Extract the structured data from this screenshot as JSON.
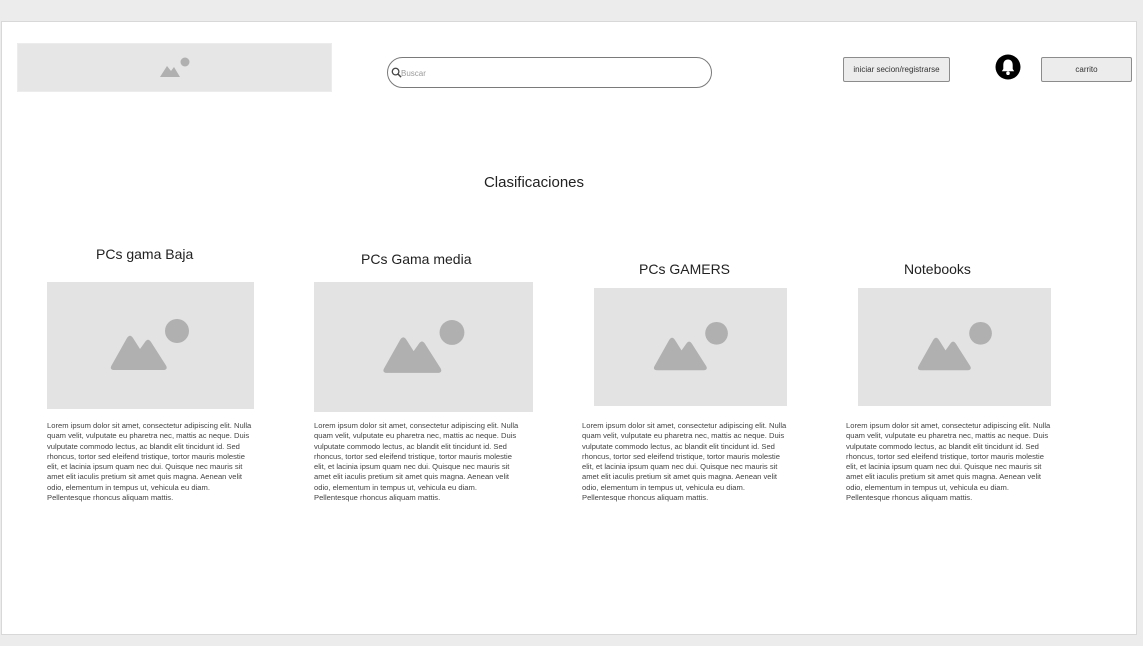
{
  "header": {
    "search_placeholder": "Buscar",
    "login_label": "iniciar secion/registrarse",
    "cart_label": "carrito"
  },
  "main": {
    "section_title": "Clasificaciones",
    "categories": [
      {
        "title": "PCs gama Baja",
        "description": "Lorem ipsum dolor sit amet, consectetur adipiscing elit. Nulla quam velit, vulputate eu pharetra nec, mattis ac neque. Duis vulputate commodo lectus, ac blandit elit tincidunt id. Sed rhoncus, tortor sed eleifend tristique, tortor mauris molestie elit, et lacinia ipsum quam nec dui. Quisque nec mauris sit amet elit iaculis pretium sit amet quis magna. Aenean velit odio, elementum in tempus ut, vehicula eu diam. Pellentesque rhoncus aliquam mattis."
      },
      {
        "title": "PCs Gama media",
        "description": "Lorem ipsum dolor sit amet, consectetur adipiscing elit. Nulla quam velit, vulputate eu pharetra nec, mattis ac neque. Duis vulputate commodo lectus, ac blandit elit tincidunt id. Sed rhoncus, tortor sed eleifend tristique, tortor mauris molestie elit, et lacinia ipsum quam nec dui. Quisque nec mauris sit amet elit iaculis pretium sit amet quis magna. Aenean velit odio, elementum in tempus ut, vehicula eu diam. Pellentesque rhoncus aliquam mattis."
      },
      {
        "title": "PCs GAMERS",
        "description": "Lorem ipsum dolor sit amet, consectetur adipiscing elit. Nulla quam velit, vulputate eu pharetra nec, mattis ac neque. Duis vulputate commodo lectus, ac blandit elit tincidunt id. Sed rhoncus, tortor sed eleifend tristique, tortor mauris molestie elit, et lacinia ipsum quam nec dui. Quisque nec mauris sit amet elit iaculis pretium sit amet quis magna. Aenean velit odio, elementum in tempus ut, vehicula eu diam. Pellentesque rhoncus aliquam mattis."
      },
      {
        "title": "Notebooks",
        "description": "Lorem ipsum dolor sit amet, consectetur adipiscing elit. Nulla quam velit, vulputate eu pharetra nec, mattis ac neque. Duis vulputate commodo lectus, ac blandit elit tincidunt id. Sed rhoncus, tortor sed eleifend tristique, tortor mauris molestie elit, et lacinia ipsum quam nec dui. Quisque nec mauris sit amet elit iaculis pretium sit amet quis magna. Aenean velit odio, elementum in tempus ut, vehicula eu diam. Pellentesque rhoncus aliquam mattis."
      }
    ]
  },
  "icons": {
    "logo": "image-placeholder-icon",
    "search": "search-icon",
    "notifications": "bell-icon",
    "category_image": "image-placeholder-icon"
  },
  "colors": {
    "placeholder_bg": "#e3e3e3",
    "placeholder_icon": "#b0b0b0",
    "page_bg": "#ffffff",
    "outer_bg": "#ececec"
  }
}
